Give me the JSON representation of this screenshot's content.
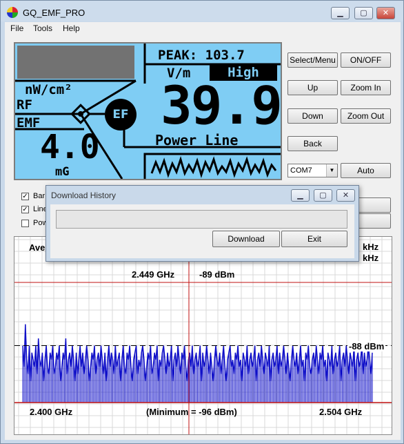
{
  "window": {
    "title": "GQ_EMF_PRO"
  },
  "window_controls": {
    "minimize": "▁",
    "maximize": "▢",
    "close": "✕"
  },
  "menu": [
    "File",
    "Tools",
    "Help"
  ],
  "lcd": {
    "peak": "PEAK: 103.7",
    "unit": "V/m",
    "level": "High",
    "value": "39.9",
    "source": "Power Line",
    "rf_unit": "nW/cm²",
    "rf_label": "RF",
    "emf_label": "EMF",
    "emf_value": "4.0",
    "emf_unit": "mG",
    "badge": "EF"
  },
  "buttons": {
    "select_menu": "Select/Menu",
    "on_off": "ON/OFF",
    "up": "Up",
    "zoom_in": "Zoom In",
    "down": "Down",
    "zoom_out": "Zoom Out",
    "back": "Back",
    "auto": "Auto"
  },
  "port": {
    "selected": "COM7"
  },
  "checkboxes": [
    {
      "label": "Bar",
      "checked": true
    },
    {
      "label": "Line",
      "checked": true
    },
    {
      "label": "Pow",
      "checked": false
    }
  ],
  "graph": {
    "ave_label": "Ave",
    "khz_1": "kHz",
    "khz_2": "kHz",
    "cursor_freq": "2.449 GHz",
    "cursor_level": "-89 dBm",
    "avg_level": "-88 dBm",
    "x_start": "2.400 GHz",
    "minimum": "(Minimum = -96 dBm)",
    "x_end": "2.504 GHz"
  },
  "dialog": {
    "title": "Download History",
    "download": "Download",
    "exit": "Exit",
    "progress": 0
  },
  "colors": {
    "bar": "#1010c8",
    "cursor": "#c01010",
    "lcd": "#7fcdf4",
    "grid": "#d8d8d8"
  },
  "chart_data": {
    "type": "bar",
    "x_range": [
      "2.400 GHz",
      "2.504 GHz"
    ],
    "avg_line": -88,
    "cursor": {
      "x": "2.449 GHz",
      "y": -89
    },
    "minimum": -96,
    "values": [
      -88,
      -91,
      -85,
      -90,
      -92,
      -88,
      -93,
      -89,
      -90,
      -91,
      -88,
      -92,
      -87,
      -90,
      -91,
      -89,
      -93,
      -90,
      -88,
      -91,
      -92,
      -89,
      -90,
      -88,
      -92,
      -91,
      -89,
      -90,
      -88,
      -93,
      -91,
      -89,
      -90,
      -87,
      -92,
      -90,
      -89,
      -91,
      -88,
      -90,
      -93,
      -89,
      -92,
      -90,
      -88,
      -91,
      -89,
      -92,
      -90,
      -88,
      -90,
      -93,
      -91,
      -89,
      -90,
      -88,
      -92,
      -90,
      -89,
      -91,
      -88,
      -90,
      -92,
      -89,
      -93,
      -90,
      -88,
      -91,
      -89,
      -90,
      -92,
      -88,
      -91,
      -90,
      -89,
      -93,
      -90,
      -88,
      -91,
      -92,
      -89,
      -90,
      -88,
      -91,
      -93,
      -90,
      -89,
      -88,
      -92,
      -90,
      -91,
      -89,
      -88,
      -90,
      -93,
      -91,
      -89,
      -90,
      -88,
      -92,
      -91,
      -89,
      -90,
      -88,
      -93,
      -90,
      -91,
      -89,
      -88,
      -90,
      -92,
      -89,
      -91,
      -90,
      -88,
      -93,
      -90,
      -89,
      -91,
      -88,
      -90,
      -92,
      -89,
      -90,
      -88,
      -91,
      -93,
      -90,
      -89,
      -91,
      -88,
      -92,
      -90,
      -89,
      -91,
      -90,
      -88,
      -93,
      -89,
      -91,
      -90,
      -88,
      -90,
      -92,
      -89,
      -91,
      -93,
      -90,
      -88,
      -90,
      -91,
      -89,
      -92,
      -90,
      -88,
      -91,
      -93,
      -90,
      -89,
      -88,
      -91,
      -90,
      -92,
      -89,
      -90,
      -88,
      -91,
      -90,
      -93,
      -89,
      -90,
      -91,
      -88,
      -92,
      -90,
      -89,
      -91,
      -90,
      -88,
      -93,
      -90,
      -89,
      -91,
      -88,
      -90,
      -92,
      -89,
      -90,
      -91,
      -88,
      -93,
      -90,
      -89,
      -91,
      -90,
      -88,
      -92,
      -89,
      -91,
      -90,
      -88,
      -90,
      -92,
      -89,
      -91,
      -93,
      -90,
      -88,
      -90,
      -91,
      -89,
      -92,
      -90,
      -88,
      -91,
      -90,
      -93,
      -89,
      -90,
      -88,
      -91,
      -92,
      -90,
      -89,
      -91,
      -88,
      -90,
      -92,
      -89,
      -90,
      -88,
      -91,
      -90,
      -93,
      -89,
      -90,
      -91,
      -88,
      -92,
      -90,
      -89,
      -91,
      -90,
      -88,
      -93,
      -90,
      -89,
      -91,
      -88,
      -90,
      -92,
      -89,
      -90,
      -91,
      -88,
      -93,
      -90,
      -89,
      -91,
      -90,
      -88,
      -92,
      -89,
      -91,
      -90,
      -88,
      -90,
      -92,
      -89
    ]
  }
}
